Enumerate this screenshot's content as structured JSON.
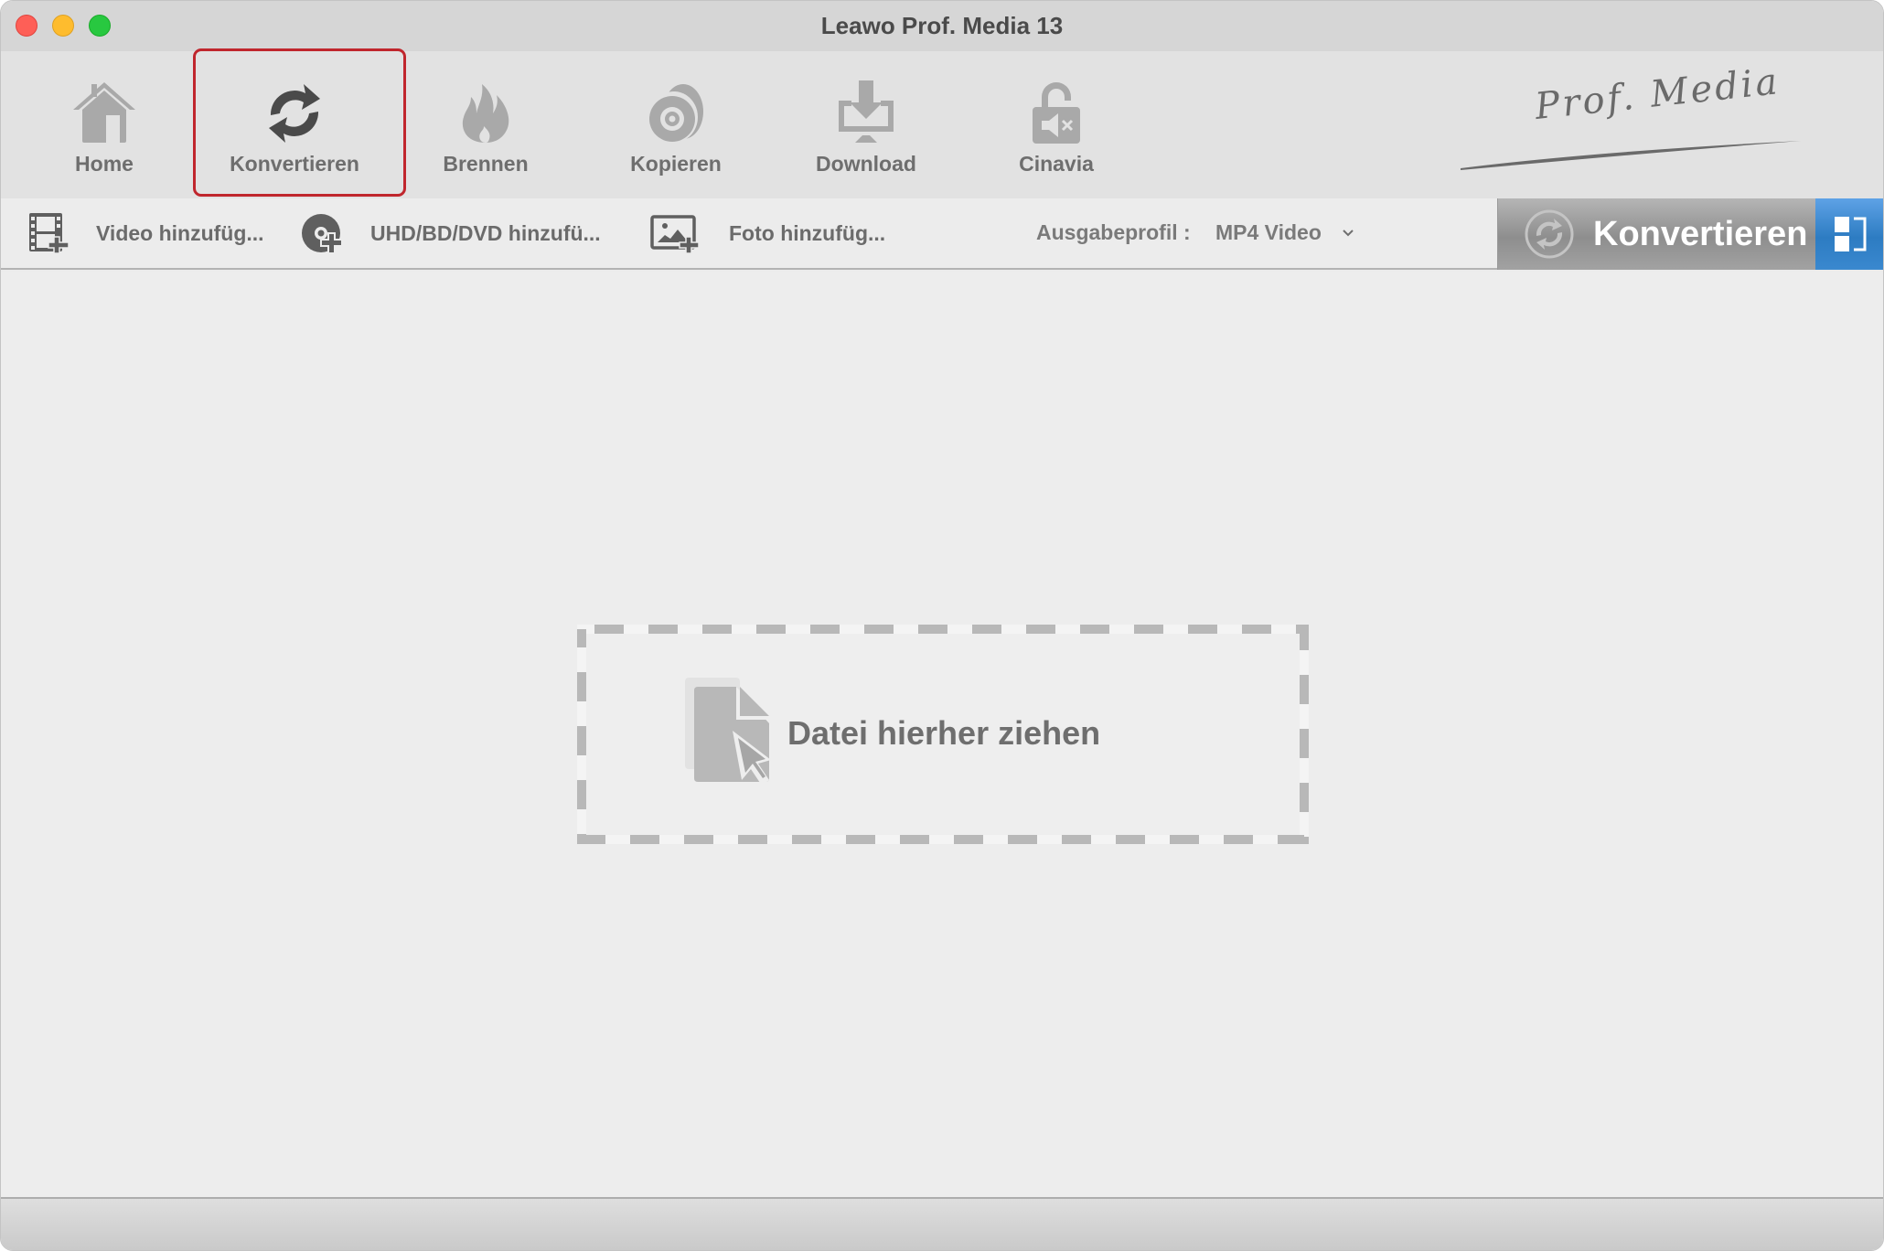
{
  "window": {
    "title": "Leawo Prof. Media 13",
    "controls": [
      "close",
      "minimize",
      "maximize"
    ]
  },
  "toolbar": {
    "active": "Konvertieren",
    "accent_color": "#c0262d",
    "items": [
      {
        "label": "Home",
        "icon": "home-icon"
      },
      {
        "label": "Konvertieren",
        "icon": "convert-icon"
      },
      {
        "label": "Brennen",
        "icon": "flame-icon"
      },
      {
        "label": "Kopieren",
        "icon": "disc-copy-icon"
      },
      {
        "label": "Download",
        "icon": "download-icon"
      },
      {
        "label": "Cinavia",
        "icon": "unlock-mute-icon"
      }
    ],
    "brand": "Prof. Media"
  },
  "subbar": {
    "add_video": "Video hinzufüg...",
    "add_disc": "UHD/BD/DVD hinzufü...",
    "add_photo": "Foto hinzufüg...",
    "profile_label": "Ausgabeprofil :",
    "profile_value": "MP4 Video",
    "convert_button": "Konvertieren",
    "convert_button_color": "#8e8e8e",
    "layout_button_color": "#2d7cc2"
  },
  "content": {
    "drop_text": "Datei hierher ziehen"
  }
}
